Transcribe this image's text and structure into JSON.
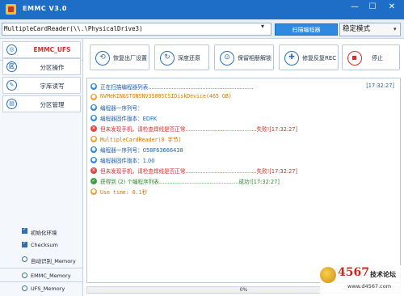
{
  "window": {
    "title": "EMMC V3.0",
    "minimize": "—",
    "maximize": "☐",
    "close": "✕"
  },
  "pathbar": {
    "device_path": "MultipleCardReader(\\\\.\\PhysicalDrive3)",
    "scan_button": "扫描编程器",
    "mode_value": "稳定模式"
  },
  "sidebar": {
    "items": [
      {
        "label": "EMMC_UFS",
        "icon": "chip-icon",
        "glyph": "◎"
      },
      {
        "label": "分区操作",
        "icon": "partition-icon",
        "glyph": "区"
      },
      {
        "label": "字库读写",
        "icon": "pen-icon",
        "glyph": "✎"
      },
      {
        "label": "分区管理",
        "icon": "list-icon",
        "glyph": "▤"
      }
    ],
    "options": [
      {
        "label": "初始化环境",
        "kind": "checkbox",
        "checked": true
      },
      {
        "label": "Checksum",
        "kind": "checkbox",
        "checked": true
      },
      {
        "label": "自动识别_Memory",
        "kind": "radio",
        "checked": false
      },
      {
        "label": "EMMC_Memory",
        "kind": "radio",
        "checked": false
      },
      {
        "label": "UFS_Memory",
        "kind": "radio",
        "checked": false
      }
    ]
  },
  "toolbar": {
    "buttons": [
      {
        "label": "恢复出厂设置",
        "icon": "restore-icon",
        "glyph": "⟲"
      },
      {
        "label": "深度还原",
        "icon": "refresh-icon",
        "glyph": "↻"
      },
      {
        "label": "保留相册解锁",
        "icon": "unlock-icon",
        "glyph": "⊙"
      },
      {
        "label": "修复反复REC",
        "icon": "repair-icon",
        "glyph": "✚"
      },
      {
        "label": "停止",
        "icon": "stop-icon",
        "glyph": ""
      }
    ]
  },
  "log": [
    {
      "status": "blue",
      "text": "正在扫描编程器列表..............................................................",
      "time": "[17:32:27]"
    },
    {
      "status": "orange",
      "text": "NVMeKINGSTONSNV3S00SCSIDiskDevice(465 GB)",
      "time": ""
    },
    {
      "status": "blue",
      "text": "编程器一序列号：",
      "time": ""
    },
    {
      "status": "blue",
      "text": "编程器固件版本：EDFK",
      "time": ""
    },
    {
      "status": "red",
      "text": "但未发现手机，请检查焊线是否正常..........................................失败![17:32:27]",
      "time": ""
    },
    {
      "status": "orange",
      "text": "MultipleCardReader(0 字节)",
      "time": ""
    },
    {
      "status": "blue",
      "text": "编程器一序列号：058F63666438",
      "time": ""
    },
    {
      "status": "blue",
      "text": "编程器固件版本：1.00",
      "time": ""
    },
    {
      "status": "red",
      "text": "但未发现手机，请检查焊线是否正常..........................................失败![17:32:27]",
      "time": ""
    },
    {
      "status": "green",
      "text": "获得到 (2) 个编程序列表...............................................成功![17:32:27]",
      "time": ""
    },
    {
      "status": "orange",
      "text": "Use time: 0.1秒",
      "time": ""
    }
  ],
  "progress": {
    "value": 0,
    "label": "0%"
  },
  "watermark": {
    "number": "4567",
    "name": "技术论坛",
    "url": "www.d4567.com"
  },
  "colors": {
    "titlebar": "#1e6ec8",
    "accent": "#2a8ae0",
    "error": "#d03030",
    "success": "#2a8a2a",
    "warning": "#c87a10"
  }
}
